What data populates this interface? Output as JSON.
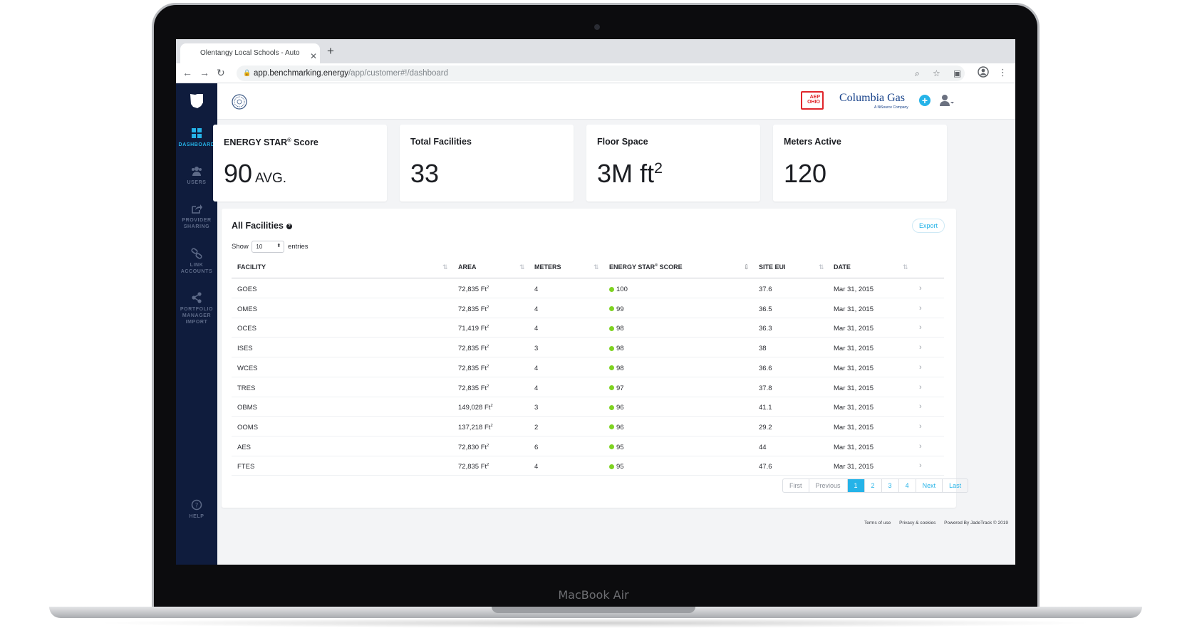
{
  "device": {
    "brand": "MacBook Air"
  },
  "browser": {
    "tab_title": "Olentangy Local Schools - Auto",
    "url_host": "app.benchmarking.energy",
    "url_path": "/app/customer#!/dashboard"
  },
  "sidebar": {
    "items": [
      {
        "label": "DASHBOARD",
        "icon": "dashboard-grid-icon",
        "active": true
      },
      {
        "label": "USERS",
        "icon": "users-icon",
        "active": false
      },
      {
        "label": "PROVIDER SHARING",
        "icon": "share-arrow-icon",
        "active": false
      },
      {
        "label": "LINK ACCOUNTS",
        "icon": "link-icon",
        "active": false
      },
      {
        "label": "PORTFOLIO MANAGER IMPORT",
        "icon": "share-nodes-icon",
        "active": false
      }
    ],
    "help_label": "HELP"
  },
  "header": {
    "aep_line1": "AEP",
    "aep_line2": "OHIO",
    "columbia_name": "Columbia Gas",
    "columbia_sub": "A NiSource Company"
  },
  "stats": [
    {
      "title": "ENERGY STAR",
      "title_sup": "®",
      "title_rest": " Score",
      "value": "90",
      "suffix": "AVG."
    },
    {
      "title": "Total Facilities",
      "value": "33"
    },
    {
      "title": "Floor Space",
      "value": "3M ft",
      "value_sup": "2"
    },
    {
      "title": "Meters Active",
      "value": "120"
    }
  ],
  "table": {
    "title": "All Facilities",
    "export_label": "Export",
    "show_label": "Show",
    "show_value": "10",
    "entries_label": "entries",
    "columns": {
      "facility": "FACILITY",
      "area": "AREA",
      "meters": "METERS",
      "energy_star": "ENERGY STAR",
      "energy_star_sup": "®",
      "energy_star_rest": " SCORE",
      "site_eui": "SITE EUI",
      "date": "DATE"
    },
    "area_unit": "Ft",
    "area_unit_sup": "2",
    "rows": [
      {
        "facility": "GOES",
        "area": "72,835",
        "meters": "4",
        "score": "100",
        "eui": "37.6",
        "date": "Mar 31, 2015"
      },
      {
        "facility": "OMES",
        "area": "72,835",
        "meters": "4",
        "score": "99",
        "eui": "36.5",
        "date": "Mar 31, 2015"
      },
      {
        "facility": "OCES",
        "area": "71,419",
        "meters": "4",
        "score": "98",
        "eui": "36.3",
        "date": "Mar 31, 2015"
      },
      {
        "facility": "ISES",
        "area": "72,835",
        "meters": "3",
        "score": "98",
        "eui": "38",
        "date": "Mar 31, 2015"
      },
      {
        "facility": "WCES",
        "area": "72,835",
        "meters": "4",
        "score": "98",
        "eui": "36.6",
        "date": "Mar 31, 2015"
      },
      {
        "facility": "TRES",
        "area": "72,835",
        "meters": "4",
        "score": "97",
        "eui": "37.8",
        "date": "Mar 31, 2015"
      },
      {
        "facility": "OBMS",
        "area": "149,028",
        "meters": "3",
        "score": "96",
        "eui": "41.1",
        "date": "Mar 31, 2015"
      },
      {
        "facility": "OOMS",
        "area": "137,218",
        "meters": "2",
        "score": "96",
        "eui": "29.2",
        "date": "Mar 31, 2015"
      },
      {
        "facility": "AES",
        "area": "72,830",
        "meters": "6",
        "score": "95",
        "eui": "44",
        "date": "Mar 31, 2015"
      },
      {
        "facility": "FTES",
        "area": "72,835",
        "meters": "4",
        "score": "95",
        "eui": "47.6",
        "date": "Mar 31, 2015"
      }
    ],
    "score_color": "#7ed321",
    "pagination": [
      "First",
      "Previous",
      "1",
      "2",
      "3",
      "4",
      "Next",
      "Last"
    ],
    "current_page": "1"
  },
  "footer": {
    "terms": "Terms of use",
    "privacy": "Privacy & cookies",
    "powered": "Powered By JadeTrack © 2019"
  },
  "colors": {
    "sidebar_bg": "#0f1c3d",
    "accent": "#25b3e8",
    "aep_red": "#e0262b",
    "columbia_blue": "#16418a"
  }
}
